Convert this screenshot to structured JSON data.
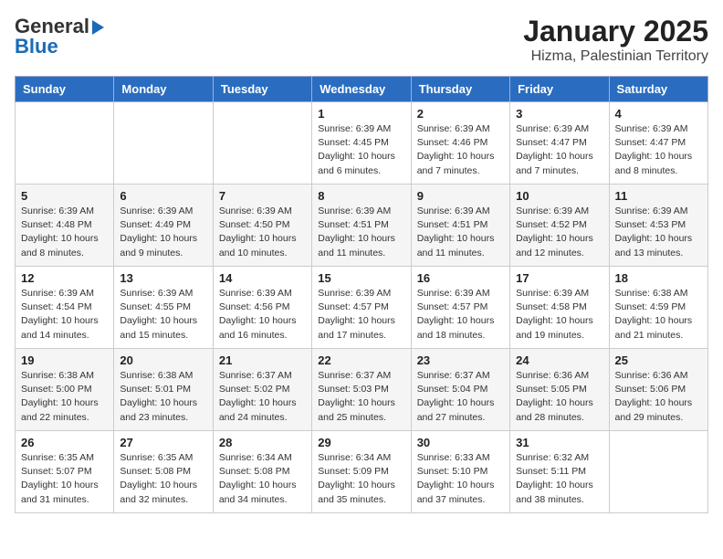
{
  "header": {
    "logo_general": "General",
    "logo_blue": "Blue",
    "title": "January 2025",
    "subtitle": "Hizma, Palestinian Territory"
  },
  "calendar": {
    "days_of_week": [
      "Sunday",
      "Monday",
      "Tuesday",
      "Wednesday",
      "Thursday",
      "Friday",
      "Saturday"
    ],
    "weeks": [
      [
        {
          "day": "",
          "info": ""
        },
        {
          "day": "",
          "info": ""
        },
        {
          "day": "",
          "info": ""
        },
        {
          "day": "1",
          "info": "Sunrise: 6:39 AM\nSunset: 4:45 PM\nDaylight: 10 hours\nand 6 minutes."
        },
        {
          "day": "2",
          "info": "Sunrise: 6:39 AM\nSunset: 4:46 PM\nDaylight: 10 hours\nand 7 minutes."
        },
        {
          "day": "3",
          "info": "Sunrise: 6:39 AM\nSunset: 4:47 PM\nDaylight: 10 hours\nand 7 minutes."
        },
        {
          "day": "4",
          "info": "Sunrise: 6:39 AM\nSunset: 4:47 PM\nDaylight: 10 hours\nand 8 minutes."
        }
      ],
      [
        {
          "day": "5",
          "info": "Sunrise: 6:39 AM\nSunset: 4:48 PM\nDaylight: 10 hours\nand 8 minutes."
        },
        {
          "day": "6",
          "info": "Sunrise: 6:39 AM\nSunset: 4:49 PM\nDaylight: 10 hours\nand 9 minutes."
        },
        {
          "day": "7",
          "info": "Sunrise: 6:39 AM\nSunset: 4:50 PM\nDaylight: 10 hours\nand 10 minutes."
        },
        {
          "day": "8",
          "info": "Sunrise: 6:39 AM\nSunset: 4:51 PM\nDaylight: 10 hours\nand 11 minutes."
        },
        {
          "day": "9",
          "info": "Sunrise: 6:39 AM\nSunset: 4:51 PM\nDaylight: 10 hours\nand 11 minutes."
        },
        {
          "day": "10",
          "info": "Sunrise: 6:39 AM\nSunset: 4:52 PM\nDaylight: 10 hours\nand 12 minutes."
        },
        {
          "day": "11",
          "info": "Sunrise: 6:39 AM\nSunset: 4:53 PM\nDaylight: 10 hours\nand 13 minutes."
        }
      ],
      [
        {
          "day": "12",
          "info": "Sunrise: 6:39 AM\nSunset: 4:54 PM\nDaylight: 10 hours\nand 14 minutes."
        },
        {
          "day": "13",
          "info": "Sunrise: 6:39 AM\nSunset: 4:55 PM\nDaylight: 10 hours\nand 15 minutes."
        },
        {
          "day": "14",
          "info": "Sunrise: 6:39 AM\nSunset: 4:56 PM\nDaylight: 10 hours\nand 16 minutes."
        },
        {
          "day": "15",
          "info": "Sunrise: 6:39 AM\nSunset: 4:57 PM\nDaylight: 10 hours\nand 17 minutes."
        },
        {
          "day": "16",
          "info": "Sunrise: 6:39 AM\nSunset: 4:57 PM\nDaylight: 10 hours\nand 18 minutes."
        },
        {
          "day": "17",
          "info": "Sunrise: 6:39 AM\nSunset: 4:58 PM\nDaylight: 10 hours\nand 19 minutes."
        },
        {
          "day": "18",
          "info": "Sunrise: 6:38 AM\nSunset: 4:59 PM\nDaylight: 10 hours\nand 21 minutes."
        }
      ],
      [
        {
          "day": "19",
          "info": "Sunrise: 6:38 AM\nSunset: 5:00 PM\nDaylight: 10 hours\nand 22 minutes."
        },
        {
          "day": "20",
          "info": "Sunrise: 6:38 AM\nSunset: 5:01 PM\nDaylight: 10 hours\nand 23 minutes."
        },
        {
          "day": "21",
          "info": "Sunrise: 6:37 AM\nSunset: 5:02 PM\nDaylight: 10 hours\nand 24 minutes."
        },
        {
          "day": "22",
          "info": "Sunrise: 6:37 AM\nSunset: 5:03 PM\nDaylight: 10 hours\nand 25 minutes."
        },
        {
          "day": "23",
          "info": "Sunrise: 6:37 AM\nSunset: 5:04 PM\nDaylight: 10 hours\nand 27 minutes."
        },
        {
          "day": "24",
          "info": "Sunrise: 6:36 AM\nSunset: 5:05 PM\nDaylight: 10 hours\nand 28 minutes."
        },
        {
          "day": "25",
          "info": "Sunrise: 6:36 AM\nSunset: 5:06 PM\nDaylight: 10 hours\nand 29 minutes."
        }
      ],
      [
        {
          "day": "26",
          "info": "Sunrise: 6:35 AM\nSunset: 5:07 PM\nDaylight: 10 hours\nand 31 minutes."
        },
        {
          "day": "27",
          "info": "Sunrise: 6:35 AM\nSunset: 5:08 PM\nDaylight: 10 hours\nand 32 minutes."
        },
        {
          "day": "28",
          "info": "Sunrise: 6:34 AM\nSunset: 5:08 PM\nDaylight: 10 hours\nand 34 minutes."
        },
        {
          "day": "29",
          "info": "Sunrise: 6:34 AM\nSunset: 5:09 PM\nDaylight: 10 hours\nand 35 minutes."
        },
        {
          "day": "30",
          "info": "Sunrise: 6:33 AM\nSunset: 5:10 PM\nDaylight: 10 hours\nand 37 minutes."
        },
        {
          "day": "31",
          "info": "Sunrise: 6:32 AM\nSunset: 5:11 PM\nDaylight: 10 hours\nand 38 minutes."
        },
        {
          "day": "",
          "info": ""
        }
      ]
    ]
  }
}
